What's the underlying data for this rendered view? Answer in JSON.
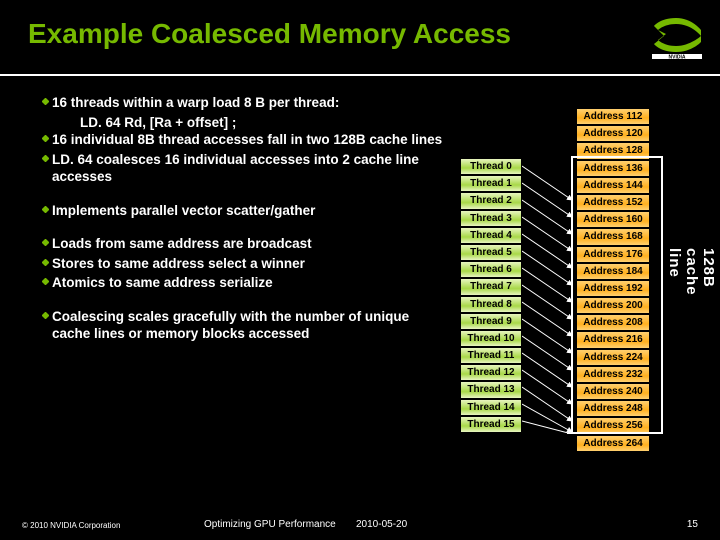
{
  "title": "Example Coalesced Memory Access",
  "bullets": {
    "b1": "16 threads within a warp load 8 B per thread:",
    "b1_sub": "LD. 64 Rd, [Ra + offset] ;",
    "b2": "16 individual 8B thread accesses fall in two 128B cache lines",
    "b3": "LD. 64 coalesces 16 individual accesses into 2 cache line accesses",
    "b4": "Implements parallel vector scatter/gather",
    "b5": "Loads from same address are broadcast",
    "b6": "Stores to same address select a winner",
    "b7": "Atomics to same address serialize",
    "b8": "Coalescing scales gracefully with the number of unique cache lines or memory blocks accessed"
  },
  "threads": [
    "Thread 0",
    "Thread 1",
    "Thread 2",
    "Thread 3",
    "Thread 4",
    "Thread 5",
    "Thread 6",
    "Thread 7",
    "Thread 8",
    "Thread 9",
    "Thread 10",
    "Thread 11",
    "Thread 12",
    "Thread 13",
    "Thread 14",
    "Thread 15"
  ],
  "addresses": [
    "Address 112",
    "Address 120",
    "Address 128",
    "Address 136",
    "Address 144",
    "Address 152",
    "Address 160",
    "Address 168",
    "Address 176",
    "Address 184",
    "Address 192",
    "Address 200",
    "Address 208",
    "Address 216",
    "Address 224",
    "Address 232",
    "Address 240",
    "Address 248",
    "Address 256",
    "Address 264"
  ],
  "cache_label": "128B cache line",
  "footer": {
    "copyright": "© 2010 NVIDIA Corporation",
    "mid": "Optimizing GPU Performance",
    "date": "2010-05-20",
    "page": "15"
  }
}
